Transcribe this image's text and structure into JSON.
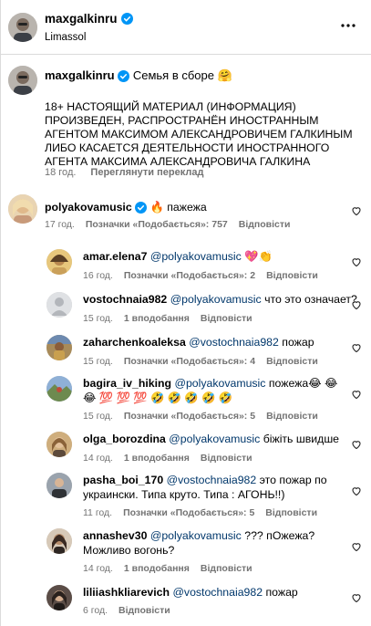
{
  "header": {
    "username": "maxgalkinru",
    "location": "Limassol"
  },
  "caption": {
    "username": "maxgalkinru",
    "title": "Семья в сборе 🤗",
    "body": "18+ НАСТОЯЩИЙ МАТЕРИАЛ (ИНФОРМАЦИЯ) ПРОИЗВЕДЕН, РАСПРОСТРАНЁН ИНОСТРАННЫМ АГЕНТОМ МАКСИМОМ АЛЕКСАНДРОВИЧЕМ ГАЛКИНЫМ ЛИБО КАСАЕТСЯ ДЕЯТЕЛЬНОСТИ ИНОСТРАННОГО АГЕНТА МАКСИМА АЛЕКСАНДРОВИЧА ГАЛКИНА",
    "time": "18 год.",
    "translate": "Переглянути переклад"
  },
  "comments": [
    {
      "username": "polyakovamusic",
      "verified": true,
      "mention": "",
      "text": "🔥 пажежа",
      "time": "17 год.",
      "likes_text": "Позначки «Подобається»: 757",
      "reply": "Відповісти",
      "avatar_color": "#d6b48a"
    },
    {
      "username": "amar.elena7",
      "mention": "@polyakovamusic",
      "text": "💖👏",
      "time": "16 год.",
      "likes_text": "Позначки «Подобається»: 2",
      "reply": "Відповісти",
      "avatar_color": "#c8a15a"
    },
    {
      "username": "vostochnaia982",
      "mention": "@polyakovamusic",
      "text": "что это означает?",
      "time": "15 год.",
      "likes_text": "1 вподобання",
      "reply": "Відповісти",
      "avatar_color": "#d4d6da"
    },
    {
      "username": "zaharchenkoaleksa",
      "mention": "@vostochnaia982",
      "text": "пожар",
      "time": "15 год.",
      "likes_text": "Позначки «Подобається»: 4",
      "reply": "Відповісти",
      "avatar_color": "#9b7b4e"
    },
    {
      "username": "bagira_iv_hiking",
      "mention": "@polyakovamusic",
      "text": "пожежа😂 😂 😂 💯 💯 💯 🤣 🤣 🤣 🤣 🤣",
      "time": "15 год.",
      "likes_text": "Позначки «Подобається»: 5",
      "reply": "Відповісти",
      "avatar_color": "#7d9a6a"
    },
    {
      "username": "olga_borozdina",
      "mention": "@polyakovamusic",
      "text": "біжіть швидше",
      "time": "14 год.",
      "likes_text": "1 вподобання",
      "reply": "Відповісти",
      "avatar_color": "#a98b63"
    },
    {
      "username": "pasha_boi_170",
      "mention": "@vostochnaia982",
      "text": "это пожар по украински. Типа круто. Типа : АГОНЬ!!)",
      "time": "11 год.",
      "likes_text": "Позначки «Подобається»: 5",
      "reply": "Відповісти",
      "avatar_color": "#8a8f96"
    },
    {
      "username": "annashev30",
      "mention": "@polyakovamusic",
      "text": "??? пОжежа? Можливо вогонь?",
      "time": "14 год.",
      "likes_text": "1 вподобання",
      "reply": "Відповісти",
      "avatar_color": "#6b5a4a"
    },
    {
      "username": "liliiashkliarevich",
      "mention": "@vostochnaia982",
      "text": "пожар",
      "time": "6 год.",
      "likes_text": "",
      "reply": "Відповісти",
      "avatar_color": "#4a3f3a"
    }
  ]
}
